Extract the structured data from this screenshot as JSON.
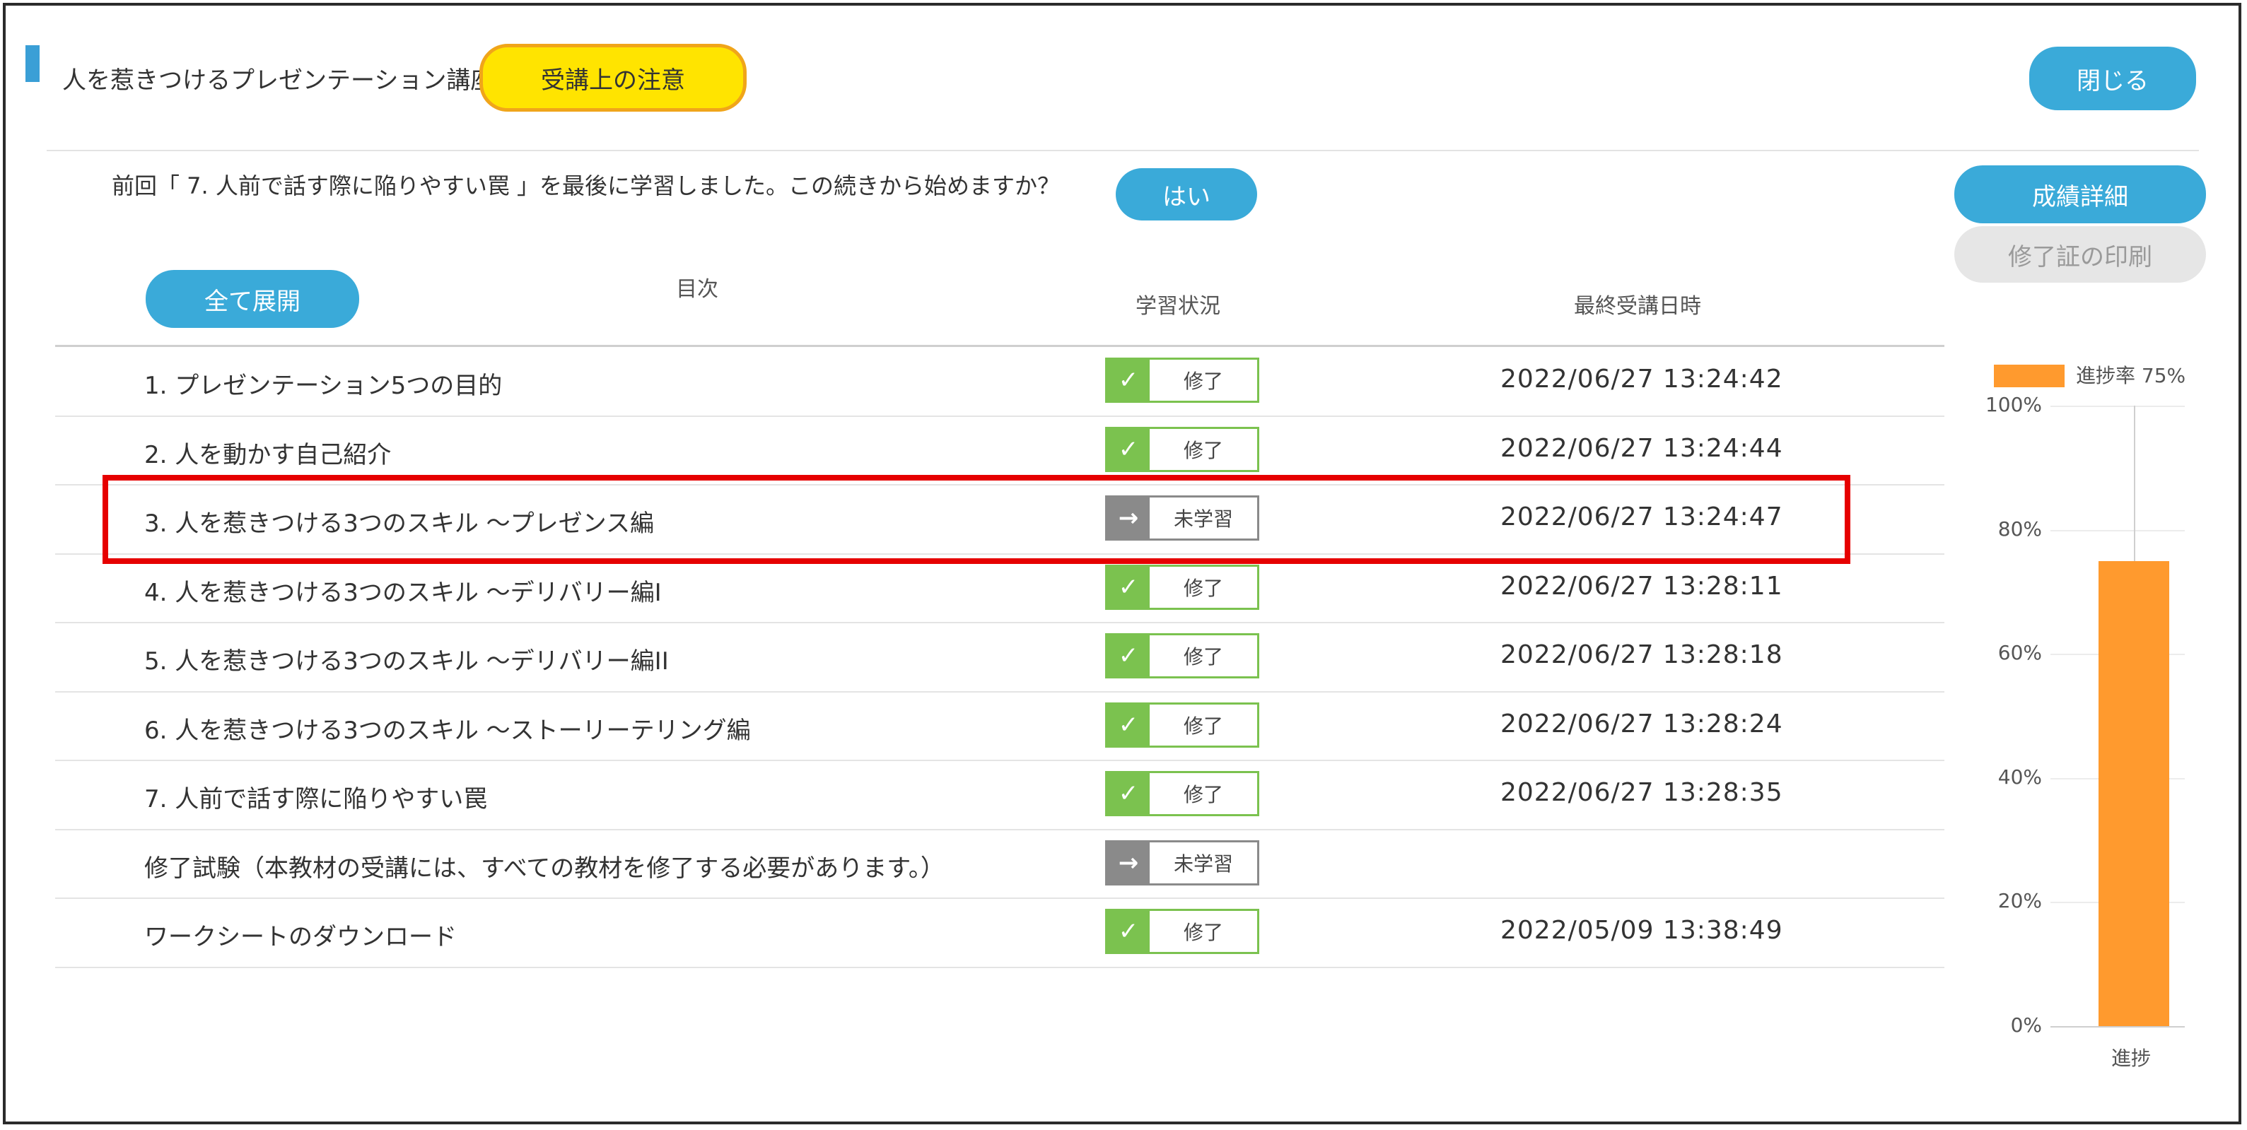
{
  "header": {
    "course_title": "人を惹きつけるプレゼンテーション講座",
    "notice_button": "受講上の注意",
    "close_button": "閉じる"
  },
  "resume": {
    "message": "前回「 7. 人前で話す際に陥りやすい罠 」を最後に学習しました。この続きから始めますか？",
    "yes_button": "はい"
  },
  "side_buttons": {
    "grade_details": "成績詳細",
    "print_certificate": "修了証の印刷"
  },
  "toc": {
    "expand_all": "全て展開",
    "col_contents": "目次",
    "col_status": "学習状況",
    "col_last_date": "最終受講日時",
    "rows": [
      {
        "title": "1. プレゼンテーション5つの目的",
        "status": "修了",
        "state": "done",
        "date": "2022/06/27 13:24:42"
      },
      {
        "title": "2. 人を動かす自己紹介",
        "status": "修了",
        "state": "done",
        "date": "2022/06/27 13:24:44"
      },
      {
        "title": "3. 人を惹きつける3つのスキル ～プレゼンス編",
        "status": "未学習",
        "state": "todo",
        "date": "2022/06/27 13:24:47"
      },
      {
        "title": "4. 人を惹きつける3つのスキル ～デリバリー編I",
        "status": "修了",
        "state": "done",
        "date": "2022/06/27 13:28:11"
      },
      {
        "title": "5. 人を惹きつける3つのスキル ～デリバリー編II",
        "status": "修了",
        "state": "done",
        "date": "2022/06/27 13:28:18"
      },
      {
        "title": "6. 人を惹きつける3つのスキル ～ストーリーテリング編",
        "status": "修了",
        "state": "done",
        "date": "2022/06/27 13:28:24"
      },
      {
        "title": "7. 人前で話す際に陥りやすい罠",
        "status": "修了",
        "state": "done",
        "date": "2022/06/27 13:28:35"
      },
      {
        "title": "修了試験（本教材の受講には、すべての教材を修了する必要があります。）",
        "status": "未学習",
        "state": "todo",
        "date": ""
      },
      {
        "title": "ワークシートのダウンロード",
        "status": "修了",
        "state": "done",
        "date": "2022/05/09 13:38:49"
      }
    ]
  },
  "icons": {
    "done": "check-icon",
    "todo": "arrow-right-icon"
  },
  "colors": {
    "accent_blue": "#3aaad9",
    "notice_yellow": "#ffe400",
    "done_green": "#7bc24f",
    "todo_gray": "#8a8a8a",
    "highlight_red": "#e60000",
    "bar_orange": "#ff9a2e"
  },
  "chart_data": {
    "type": "bar",
    "categories": [
      "進捗"
    ],
    "series": [
      {
        "name": "進捗率 75%",
        "values": [
          75
        ]
      }
    ],
    "ylim": [
      0,
      100
    ],
    "yticks": [
      "0%",
      "20%",
      "40%",
      "60%",
      "80%",
      "100%"
    ],
    "tick_values": [
      0,
      20,
      40,
      60,
      80,
      100
    ],
    "grid": true,
    "legend": "top"
  }
}
